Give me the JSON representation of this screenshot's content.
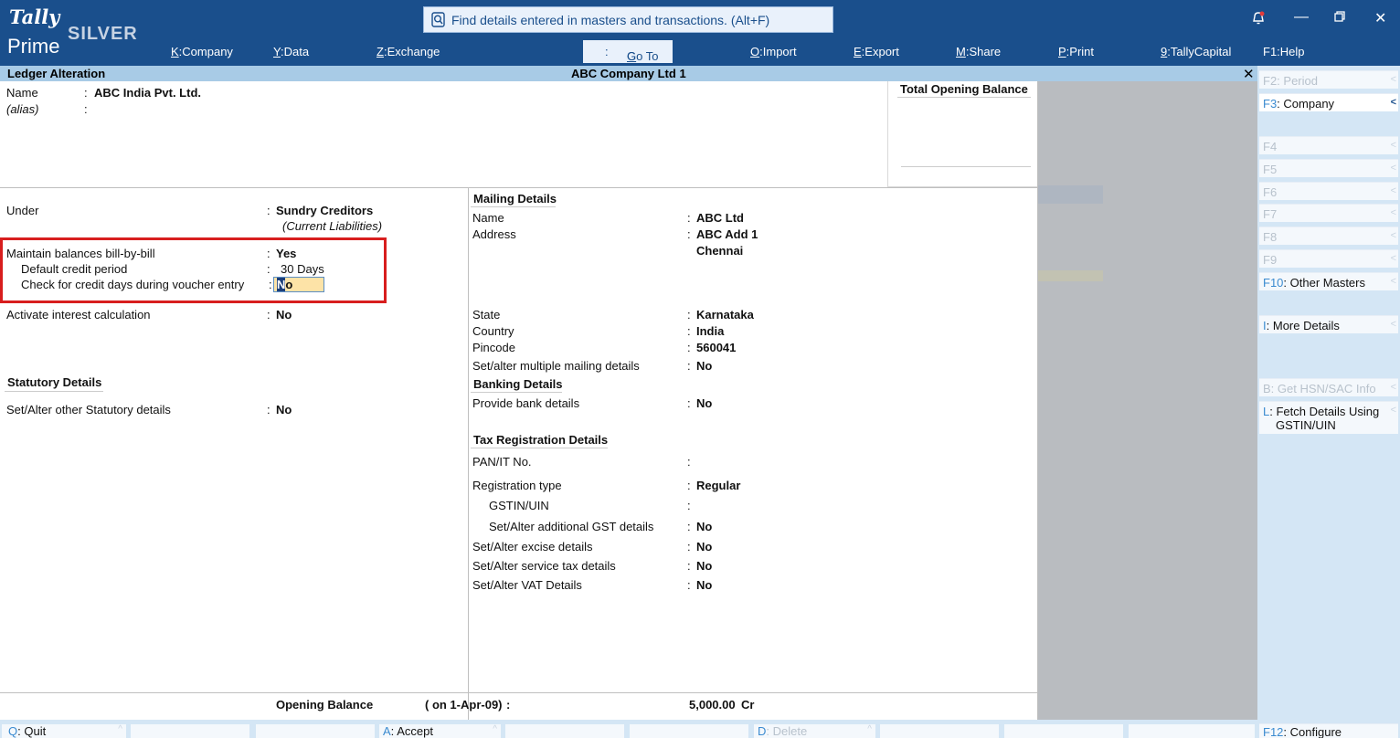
{
  "app": {
    "logo_top": "Tally",
    "logo_bottom": "Prime",
    "edition": "SILVER",
    "search_placeholder": "Find details entered in masters and transactions. (Alt+F)"
  },
  "menu": [
    {
      "key": "K",
      "label": "Company"
    },
    {
      "key": "Y",
      "label": "Data"
    },
    {
      "key": "Z",
      "label": "Exchange"
    },
    {
      "key": "G",
      "label": "Go To"
    },
    {
      "key": "O",
      "label": "Import"
    },
    {
      "key": "E",
      "label": "Export"
    },
    {
      "key": "M",
      "label": "Share"
    },
    {
      "key": "P",
      "label": "Print"
    },
    {
      "key": "9",
      "label": "TallyCapital"
    },
    {
      "key": "F1",
      "label": "Help"
    }
  ],
  "title": {
    "screen": "Ledger Alteration",
    "company": "ABC Company Ltd 1",
    "close": "✕"
  },
  "ledger": {
    "name_label": "Name",
    "name_value": "ABC India Pvt. Ltd.",
    "alias_label": "(alias)",
    "total_opening_balance": "Total Opening Balance"
  },
  "left": {
    "under_label": "Under",
    "under_value": "Sundry Creditors",
    "under_sub": "(Current Liabilities)",
    "maintain_label": "Maintain balances bill-by-bill",
    "maintain_value": "Yes",
    "credit_period_label": "Default credit period",
    "credit_period_value": "30 Days",
    "check_label": "Check for credit days during voucher entry",
    "check_value_cursor": "N",
    "check_value_rest": "o",
    "interest_label": "Activate interest calculation",
    "interest_value": "No",
    "statutory_heading": "Statutory Details",
    "statutory_label": "Set/Alter other Statutory details",
    "statutory_value": "No"
  },
  "mailing": {
    "heading": "Mailing Details",
    "name_label": "Name",
    "name_value": "ABC Ltd",
    "address_label": "Address",
    "address_line1": "ABC Add 1",
    "address_line2": "Chennai",
    "state_label": "State",
    "state_value": "Karnataka",
    "country_label": "Country",
    "country_value": "India",
    "pincode_label": "Pincode",
    "pincode_value": "560041",
    "multi_label": "Set/alter multiple mailing details",
    "multi_value": "No"
  },
  "banking": {
    "heading": "Banking Details",
    "label": "Provide bank details",
    "value": "No"
  },
  "tax": {
    "heading": "Tax Registration Details",
    "pan_label": "PAN/IT No.",
    "regtype_label": "Registration type",
    "regtype_value": "Regular",
    "gstin_label": "GSTIN/UIN",
    "addl_gst_label": "Set/Alter additional GST details",
    "addl_gst_value": "No",
    "excise_label": "Set/Alter excise details",
    "excise_value": "No",
    "service_label": "Set/Alter service tax details",
    "service_value": "No",
    "vat_label": "Set/Alter VAT Details",
    "vat_value": "No"
  },
  "opening": {
    "label": "Opening Balance",
    "date": "( on 1-Apr-09)",
    "amount": "5,000.00",
    "type": "Cr"
  },
  "right_buttons": [
    {
      "key": "F2",
      "label": "Period"
    },
    {
      "key": "F3",
      "label": "Company"
    },
    {
      "key": "F4",
      "label": ""
    },
    {
      "key": "F5",
      "label": ""
    },
    {
      "key": "F6",
      "label": ""
    },
    {
      "key": "F7",
      "label": ""
    },
    {
      "key": "F8",
      "label": ""
    },
    {
      "key": "F9",
      "label": ""
    },
    {
      "key": "F10",
      "label": "Other Masters"
    },
    {
      "key": "I",
      "label": "More Details"
    },
    {
      "key": "B",
      "label": "Get HSN/SAC Info"
    },
    {
      "key": "L",
      "label": "Fetch Details Using"
    },
    {
      "key": "",
      "label": "GSTIN/UIN"
    },
    {
      "key": "F12",
      "label": "Configure"
    }
  ],
  "bottom_buttons": [
    {
      "key": "Q",
      "label": "Quit"
    },
    {
      "key": "A",
      "label": "Accept"
    },
    {
      "key": "D",
      "label": "Delete"
    }
  ]
}
